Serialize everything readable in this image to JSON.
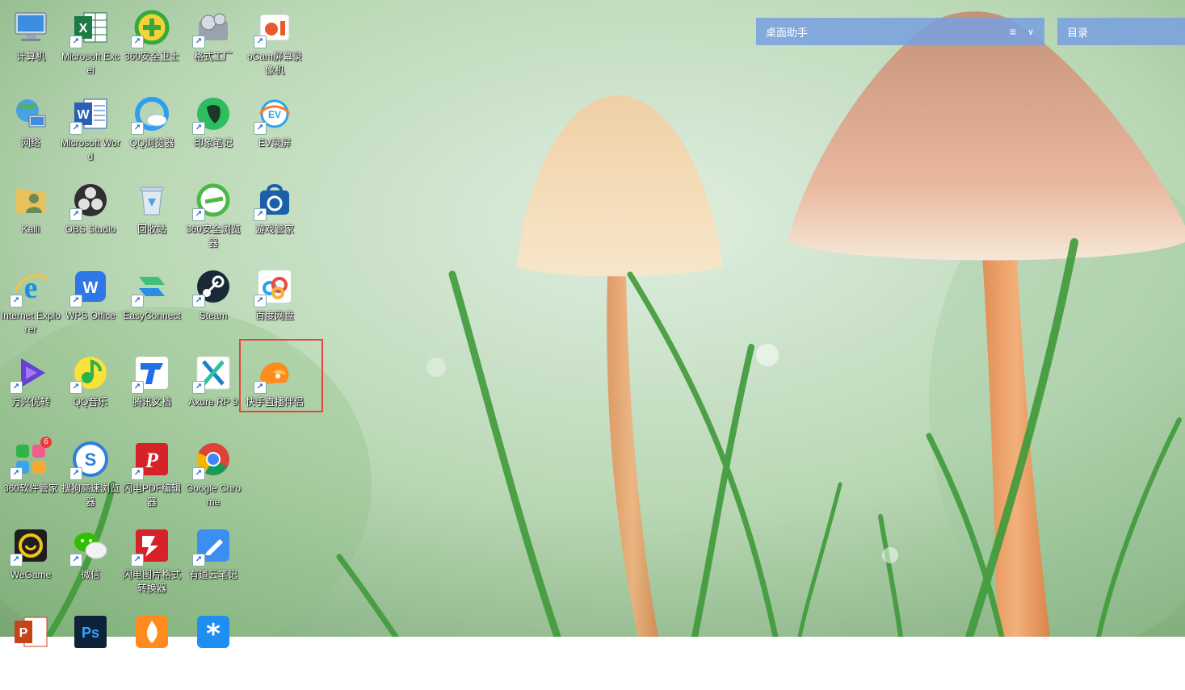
{
  "desktop": {
    "icons": [
      {
        "label": "计算机",
        "shortcut": false,
        "icon": "computer-icon"
      },
      {
        "label": "Microsoft Excel",
        "shortcut": true,
        "icon": "excel-icon"
      },
      {
        "label": "360安全卫士",
        "shortcut": true,
        "icon": "360-security-icon"
      },
      {
        "label": "格式工厂",
        "shortcut": true,
        "icon": "format-factory-icon"
      },
      {
        "label": "oCam屏幕录像机",
        "shortcut": true,
        "icon": "ocam-icon"
      },
      {
        "label": "网络",
        "shortcut": false,
        "icon": "network-icon"
      },
      {
        "label": "Microsoft Word",
        "shortcut": true,
        "icon": "word-icon"
      },
      {
        "label": "QQ浏览器",
        "shortcut": true,
        "icon": "qq-browser-icon"
      },
      {
        "label": "印象笔记",
        "shortcut": true,
        "icon": "evernote-icon"
      },
      {
        "label": "EV录屏",
        "shortcut": true,
        "icon": "ev-recorder-icon"
      },
      {
        "label": "Kalli",
        "shortcut": false,
        "icon": "user-folder-icon"
      },
      {
        "label": "OBS Studio",
        "shortcut": true,
        "icon": "obs-icon"
      },
      {
        "label": "回收站",
        "shortcut": false,
        "icon": "recycle-bin-icon"
      },
      {
        "label": "360安全浏览器",
        "shortcut": true,
        "icon": "360-browser-icon"
      },
      {
        "label": "游戏管家",
        "shortcut": true,
        "icon": "game-manager-icon"
      },
      {
        "label": "Internet Explorer",
        "shortcut": true,
        "icon": "internet-explorer-icon"
      },
      {
        "label": "WPS Office",
        "shortcut": true,
        "icon": "wps-icon"
      },
      {
        "label": "EasyConnect",
        "shortcut": true,
        "icon": "easyconnect-icon"
      },
      {
        "label": "Steam",
        "shortcut": true,
        "icon": "steam-icon"
      },
      {
        "label": "百度网盘",
        "shortcut": true,
        "icon": "baidu-netdisk-icon"
      },
      {
        "label": "万兴优转",
        "shortcut": true,
        "icon": "uniconverter-icon"
      },
      {
        "label": "QQ音乐",
        "shortcut": true,
        "icon": "qq-music-icon"
      },
      {
        "label": "腾讯文档",
        "shortcut": true,
        "icon": "tencent-docs-icon"
      },
      {
        "label": "Axure RP 9",
        "shortcut": true,
        "icon": "axure-icon"
      },
      {
        "label": "快手直播伴侣",
        "shortcut": true,
        "icon": "kuaishou-live-icon"
      },
      {
        "label": "360软件管家",
        "shortcut": true,
        "icon": "360-software-icon",
        "badge": "6"
      },
      {
        "label": "搜狗高速浏览器",
        "shortcut": true,
        "icon": "sogou-browser-icon"
      },
      {
        "label": "闪电PDF编辑器",
        "shortcut": true,
        "icon": "flash-pdf-icon"
      },
      {
        "label": "Google Chrome",
        "shortcut": true,
        "icon": "chrome-icon"
      },
      {
        "label": "WeGame",
        "shortcut": true,
        "icon": "wegame-icon"
      },
      {
        "label": "微信",
        "shortcut": true,
        "icon": "wechat-icon"
      },
      {
        "label": "闪电图片格式转换器",
        "shortcut": true,
        "icon": "flash-image-converter-icon"
      },
      {
        "label": "有道云笔记",
        "shortcut": true,
        "icon": "youdao-note-icon"
      },
      {
        "label": "",
        "shortcut": false,
        "icon": "powerpoint-icon"
      },
      {
        "label": "",
        "shortcut": false,
        "icon": "photoshop-icon"
      },
      {
        "label": "",
        "shortcut": false,
        "icon": "flame-app-icon"
      },
      {
        "label": "",
        "shortcut": false,
        "icon": "asterisk-app-icon"
      }
    ]
  },
  "widgets": {
    "desktop_assistant": {
      "title": "桌面助手",
      "menu_icon": "≡",
      "chevron_icon": "∨"
    },
    "directory": {
      "title": "目录"
    }
  },
  "colors": {
    "highlight": "#e0463c",
    "widget_bg": "#78a0e1"
  }
}
